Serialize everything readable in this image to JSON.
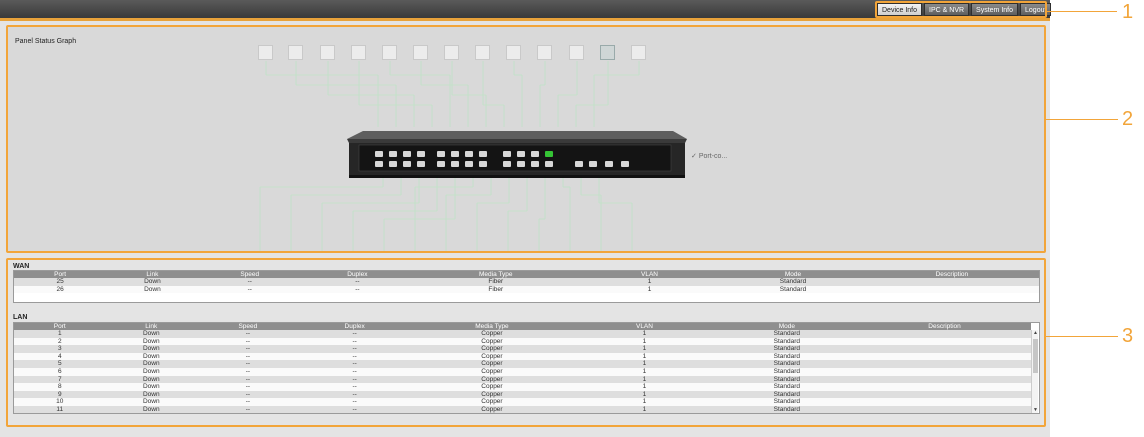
{
  "tabs": [
    {
      "label": "Device Info"
    },
    {
      "label": "IPC & NVR"
    },
    {
      "label": "System Info"
    },
    {
      "label": "Logout"
    }
  ],
  "panel": {
    "title": "Panel Status Graph",
    "legend": "Port-co..."
  },
  "callouts": {
    "c1": "1",
    "c2": "2",
    "c3": "3"
  },
  "wan": {
    "title": "WAN",
    "columns": [
      "Port",
      "Link",
      "Speed",
      "Duplex",
      "Media Type",
      "VLAN",
      "Mode",
      "Description"
    ],
    "rows": [
      [
        "25",
        "Down",
        "--",
        "--",
        "Fiber",
        "1",
        "Standard",
        ""
      ],
      [
        "26",
        "Down",
        "--",
        "--",
        "Fiber",
        "1",
        "Standard",
        ""
      ]
    ]
  },
  "lan": {
    "title": "LAN",
    "columns": [
      "Port",
      "Link",
      "Speed",
      "Duplex",
      "Media Type",
      "VLAN",
      "Mode",
      "Description"
    ],
    "rows": [
      [
        "1",
        "Down",
        "--",
        "--",
        "Copper",
        "1",
        "Standard",
        ""
      ],
      [
        "2",
        "Down",
        "--",
        "--",
        "Copper",
        "1",
        "Standard",
        ""
      ],
      [
        "3",
        "Down",
        "--",
        "--",
        "Copper",
        "1",
        "Standard",
        ""
      ],
      [
        "4",
        "Down",
        "--",
        "--",
        "Copper",
        "1",
        "Standard",
        ""
      ],
      [
        "5",
        "Down",
        "--",
        "--",
        "Copper",
        "1",
        "Standard",
        ""
      ],
      [
        "6",
        "Down",
        "--",
        "--",
        "Copper",
        "1",
        "Standard",
        ""
      ],
      [
        "7",
        "Down",
        "--",
        "--",
        "Copper",
        "1",
        "Standard",
        ""
      ],
      [
        "8",
        "Down",
        "--",
        "--",
        "Copper",
        "1",
        "Standard",
        ""
      ],
      [
        "9",
        "Down",
        "--",
        "--",
        "Copper",
        "1",
        "Standard",
        ""
      ],
      [
        "10",
        "Down",
        "--",
        "--",
        "Copper",
        "1",
        "Standard",
        ""
      ],
      [
        "11",
        "Down",
        "--",
        "--",
        "Copper",
        "1",
        "Standard",
        ""
      ]
    ]
  },
  "colors": {
    "accent": "#f2a53a",
    "port_active": "#35c435",
    "port_idle": "#d8d8d8"
  }
}
